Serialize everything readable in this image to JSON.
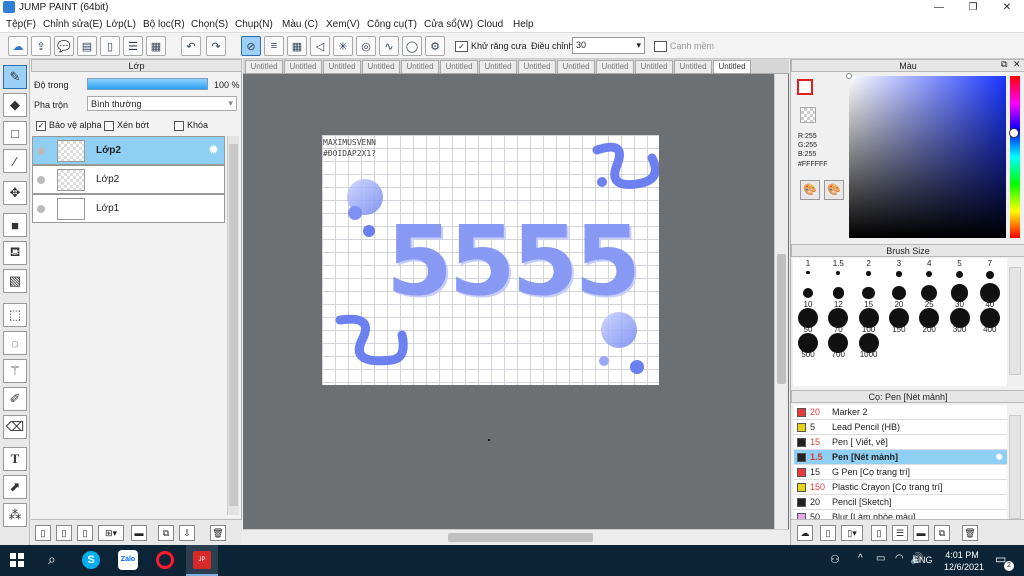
{
  "window": {
    "title": "JUMP PAINT (64bit)",
    "min": "—",
    "max": "❐",
    "close": "✕"
  },
  "menu": [
    "Tệp(F)",
    "Chỉnh sửa(E)",
    "Lớp(L)",
    "Bộ lọc(R)",
    "Chọn(S)",
    "Chụp(N)",
    "Màu (C)",
    "Xem(V)",
    "Công cụ(T)",
    "Cửa sổ(W)",
    "Cloud",
    "Help"
  ],
  "toolbar": {
    "antialias_label": "Khử răng cưa",
    "adjust_label": "Điều chỉnh",
    "adjust_value": "30",
    "smooth_label": "Cạnh mềm",
    "antialias_checked": true
  },
  "layer_panel": {
    "title": "Lớp",
    "opacity_label": "Độ trong",
    "opacity_value": "100 %",
    "opacity_fraction": 1.0,
    "blend_label": "Pha trộn",
    "blend_value": "Bình thường",
    "protect_alpha": "Bảo vệ alpha",
    "clip": "Xén bớt",
    "lock": "Khóa",
    "layers": [
      {
        "name": "Lớp2",
        "selected": true
      },
      {
        "name": "Lớp2",
        "selected": false
      },
      {
        "name": "Lớp1",
        "selected": false
      }
    ]
  },
  "tabs": [
    "Untitled",
    "Untitled",
    "Untitled",
    "Untitled",
    "Untitled",
    "Untitled",
    "Untitled",
    "Untitled",
    "Untitled",
    "Untitled",
    "Untitled",
    "Untitled",
    "Untitled"
  ],
  "canvas": {
    "art_text_top": "MAXIMUSVENN",
    "art_text_sub": "#ĐOIDAP2X1?",
    "big_number": "5555"
  },
  "color_panel": {
    "title": "Màu",
    "r": "R:255",
    "g": "G:255",
    "b": "B:255",
    "hex": "#FFFFFF",
    "primary": "#ffffff",
    "secondary": "#ffffff",
    "accent_red": "#e02020"
  },
  "brush_size_panel": {
    "title": "Brush Size",
    "sizes": [
      "1",
      "1.5",
      "2",
      "3",
      "4",
      "5",
      "7",
      "10",
      "12",
      "15",
      "20",
      "25",
      "30",
      "40",
      "50",
      "70",
      "100",
      "150",
      "200",
      "300",
      "400",
      "500",
      "700",
      "1000"
    ]
  },
  "brush_list_panel": {
    "title": "Cọ: Pen [Nét mảnh]",
    "brushes": [
      {
        "size": "20",
        "name": "Marker 2",
        "color": "#e83a3a",
        "num_color": "#e03a3a"
      },
      {
        "size": "5",
        "name": "Lead Pencil (HB)",
        "color": "#e6d21a",
        "num_color": "#222222"
      },
      {
        "size": "15",
        "name": "Pen [ Viết, vẽ]",
        "color": "#222222",
        "num_color": "#e03a3a"
      },
      {
        "size": "1.5",
        "name": "Pen [Nét mảnh]",
        "color": "#222222",
        "num_color": "#e03a3a",
        "selected": true
      },
      {
        "size": "15",
        "name": "G Pen [Cọ trang trí]",
        "color": "#e83a3a",
        "num_color": "#222222"
      },
      {
        "size": "150",
        "name": "Plastic Crayon [Cọ trang trí]",
        "color": "#e6d21a",
        "num_color": "#e03a3a"
      },
      {
        "size": "20",
        "name": "Pencil [Sketch]",
        "color": "#222222",
        "num_color": "#222222"
      },
      {
        "size": "50",
        "name": "Blur [Làm nhòe màu]",
        "color": "#e8a6e8",
        "num_color": "#222222"
      }
    ]
  },
  "taskbar": {
    "lang": "ENG",
    "time": "4:01 PM",
    "date": "12/6/2021",
    "notify_count": "2",
    "zalo": "Zalo"
  }
}
